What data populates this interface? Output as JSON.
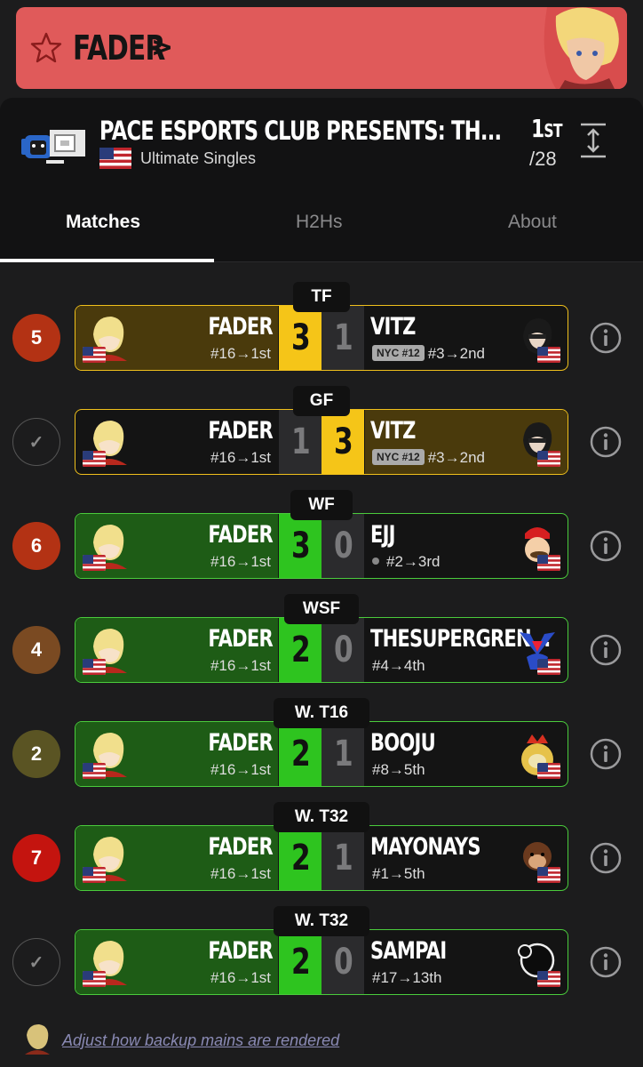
{
  "banner": {
    "player": "FADER",
    "chevron": ">"
  },
  "event": {
    "title": "PACE ESPORTS CLUB PRESENTS: TH...",
    "game": "Ultimate Singles",
    "placement": "1",
    "placement_suffix": "ST",
    "entrants": "/28"
  },
  "tabs": [
    "Matches",
    "H2Hs",
    "About"
  ],
  "matches": [
    {
      "round": "TF",
      "seed_badge": "5",
      "badge_color": "#b33214",
      "p1": "FADER",
      "p1_seed": "#16→1st",
      "s1": "3",
      "s2": "1",
      "p2": "VITZ",
      "p2_tag": "NYC #12",
      "p2_seed": "#3→2nd",
      "style": "tf-left"
    },
    {
      "round": "GF",
      "seed_badge": "✓",
      "badge_color": "",
      "p1": "FADER",
      "p1_seed": "#16→1st",
      "s1": "1",
      "s2": "3",
      "p2": "VITZ",
      "p2_tag": "NYC #12",
      "p2_seed": "#3→2nd",
      "style": "tf-right"
    },
    {
      "round": "WF",
      "seed_badge": "6",
      "badge_color": "#b33214",
      "p1": "FADER",
      "p1_seed": "#16→1st",
      "s1": "3",
      "s2": "0",
      "p2": "EJJ",
      "p2_seed": "#2→3rd",
      "style": "win"
    },
    {
      "round": "WSF",
      "seed_badge": "4",
      "badge_color": "#7a4a22",
      "p1": "FADER",
      "p1_seed": "#16→1st",
      "s1": "2",
      "s2": "0",
      "p2": "THESUPERGREN...",
      "p2_seed": "#4→4th",
      "style": "win"
    },
    {
      "round": "W. T16",
      "seed_badge": "2",
      "badge_color": "#5a5423",
      "p1": "FADER",
      "p1_seed": "#16→1st",
      "s1": "2",
      "s2": "1",
      "p2": "BOOJU",
      "p2_seed": "#8→5th",
      "style": "win"
    },
    {
      "round": "W. T32",
      "seed_badge": "7",
      "badge_color": "#c4140f",
      "p1": "FADER",
      "p1_seed": "#16→1st",
      "s1": "2",
      "s2": "1",
      "p2": "MAYONAYS",
      "p2_seed": "#1→5th",
      "style": "win"
    },
    {
      "round": "W. T32",
      "seed_badge": "✓",
      "badge_color": "",
      "p1": "FADER",
      "p1_seed": "#16→1st",
      "s1": "2",
      "s2": "0",
      "p2": "SAMPAI",
      "p2_seed": "#17→13th",
      "style": "win"
    }
  ],
  "footer": {
    "link": "Adjust how backup mains are rendered"
  },
  "colors": {
    "banner": "#e05a5a",
    "win_green": "#2ec41f",
    "tf_gold": "#f5c518"
  }
}
